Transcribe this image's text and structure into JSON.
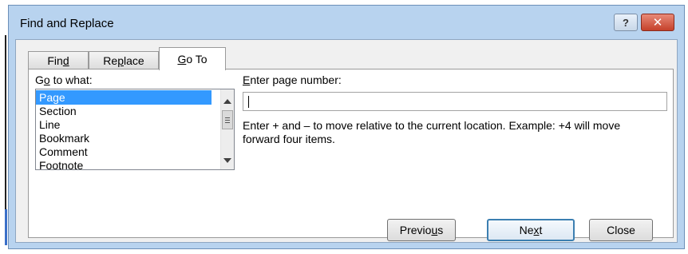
{
  "window": {
    "title": "Find and Replace",
    "help_glyph": "?",
    "close_glyph": "✕"
  },
  "tabs": [
    {
      "pre": "Fin",
      "u": "d",
      "post": ""
    },
    {
      "pre": "Re",
      "u": "p",
      "post": "lace"
    },
    {
      "pre": "",
      "u": "G",
      "post": "o To"
    }
  ],
  "goto": {
    "label_pre": "G",
    "label_u": "o",
    "label_post": " to what:",
    "items": [
      "Page",
      "Section",
      "Line",
      "Bookmark",
      "Comment",
      "Footnote"
    ],
    "selected": "Page"
  },
  "page": {
    "label_u": "E",
    "label_post": "nter page number:",
    "value": "",
    "hint": "Enter + and – to move relative to the current location. Example: +4 will move forward four items."
  },
  "buttons": {
    "previous": {
      "pre": "Previo",
      "u": "u",
      "post": "s"
    },
    "next": {
      "pre": "Ne",
      "u": "x",
      "post": "t"
    },
    "close": {
      "pre": "Close",
      "u": "",
      "post": ""
    }
  },
  "colors": {
    "selection": "#3399ff",
    "titlebar": "#b8d3ef",
    "close": "#c5412b"
  }
}
